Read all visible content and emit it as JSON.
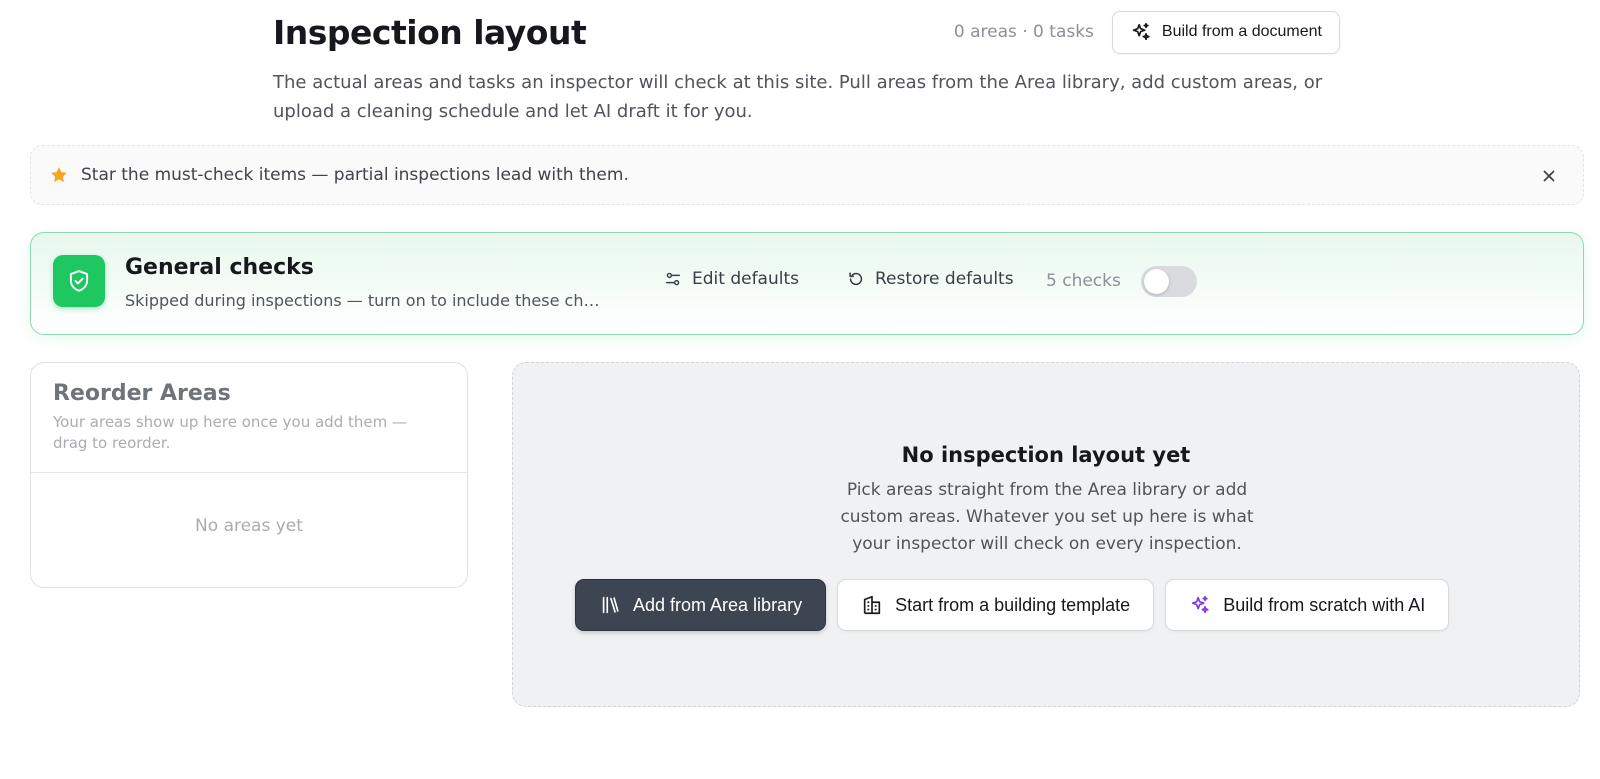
{
  "header": {
    "title": "Inspection layout",
    "counts": "0 areas · 0 tasks",
    "build_doc_label": "Build from a document",
    "subtitle": "The actual areas and tasks an inspector will check at this site. Pull areas from the Area library, add custom areas, or upload a cleaning schedule and let AI draft it for you."
  },
  "tip": {
    "text": "Star the must-check items — partial inspections lead with them."
  },
  "general_checks": {
    "title": "General checks",
    "subtitle": "Skipped during inspections — turn on to include these checks",
    "edit_label": "Edit defaults",
    "restore_label": "Restore defaults",
    "count": "5 checks",
    "enabled": false
  },
  "reorder": {
    "title": "Reorder Areas",
    "subtitle": "Your areas show up here once you add them — drag to reorder.",
    "empty": "No areas yet"
  },
  "empty_state": {
    "title": "No inspection layout yet",
    "description": "Pick areas straight from the Area library or add custom areas. Whatever you set up here is what your inspector will check on every inspection.",
    "actions": {
      "library": "Add from Area library",
      "template": "Start from a building template",
      "ai": "Build from scratch with AI"
    }
  },
  "colors": {
    "accent_green": "#1ec760",
    "primary_button": "#3d4452",
    "star": "#f5a623",
    "ai_purple": "#7c3aed"
  }
}
